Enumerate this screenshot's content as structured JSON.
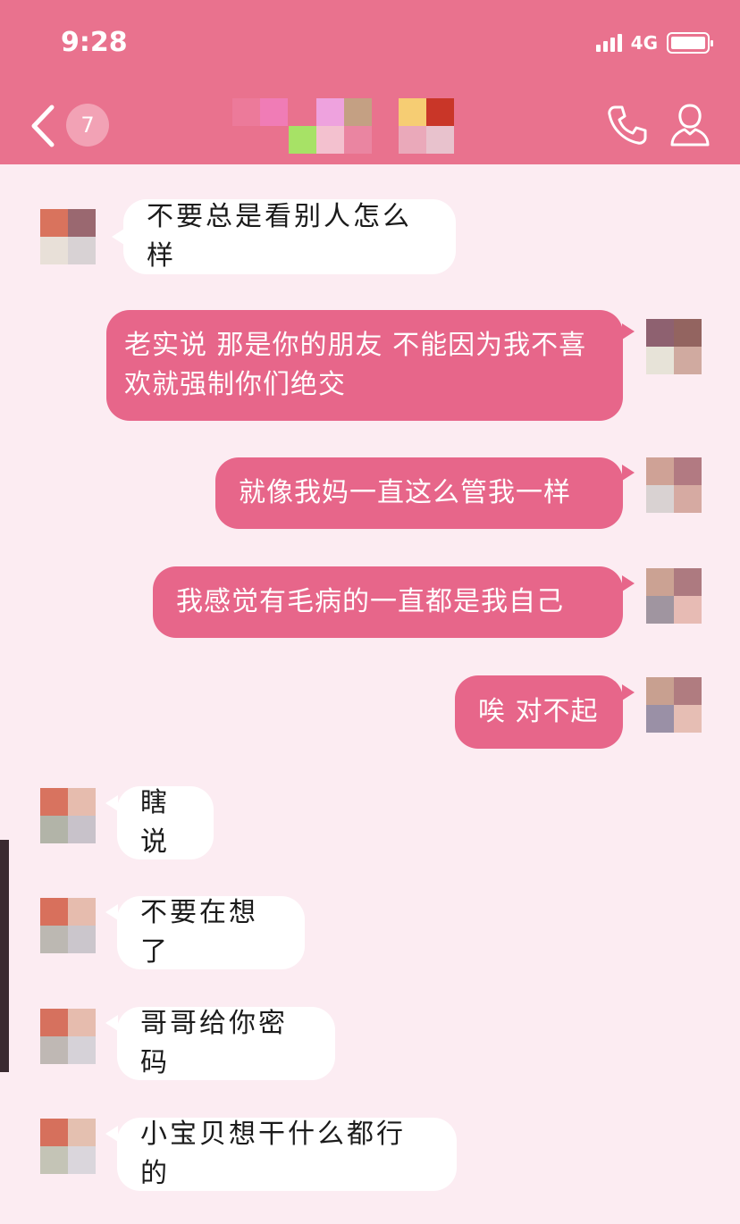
{
  "status": {
    "time": "9:28",
    "network": "4G"
  },
  "header": {
    "unread_count": "7",
    "icons": [
      "back-chevron-icon",
      "phone-icon",
      "profile-icon"
    ],
    "accent": "#e9728e"
  },
  "messages": [
    {
      "side": "in",
      "text": "不要总是看别人怎么样"
    },
    {
      "side": "out",
      "text": "老实说 那是你的朋友 不能因为我不喜欢就强制你们绝交"
    },
    {
      "side": "out",
      "text": "就像我妈一直这么管我一样"
    },
    {
      "side": "out",
      "text": "我感觉有毛病的一直都是我自己"
    },
    {
      "side": "out",
      "text": "唉 对不起"
    },
    {
      "side": "in",
      "text": "瞎说"
    },
    {
      "side": "in",
      "text": "不要在想了"
    },
    {
      "side": "in",
      "text": "哥哥给你密码"
    },
    {
      "side": "in",
      "text": "小宝贝想干什么都行的"
    }
  ],
  "colors": {
    "background": "#fcecf2",
    "incoming_bubble": "#ffffff",
    "outgoing_bubble": "#e7668a"
  }
}
